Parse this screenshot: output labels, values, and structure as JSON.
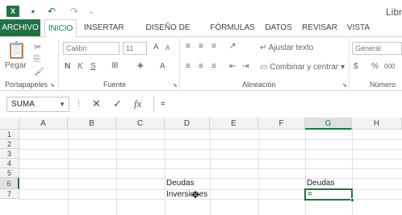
{
  "titlebar": {
    "app_icon": "excel-icon",
    "title": "Libr"
  },
  "tabs": [
    "ARCHIVO",
    "INICIO",
    "INSERTAR",
    "DISEÑO DE PÁGINA",
    "FÓRMULAS",
    "DATOS",
    "REVISAR",
    "VISTA"
  ],
  "ribbon": {
    "clipboard": {
      "paste_label": "Pegar",
      "group_label": "Portapapeles"
    },
    "font": {
      "font_name": "Calibri",
      "font_size": "11",
      "bold": "N",
      "italic": "K",
      "underline": "S",
      "grow": "A",
      "shrink": "A",
      "group_label": "Fuente"
    },
    "alignment": {
      "wrap_text": "Ajustar texto",
      "merge_center": "Combinar y centrar",
      "group_label": "Alineación"
    },
    "number": {
      "format": "General",
      "percent": "%",
      "thousands": "000",
      "group_label": "Número"
    }
  },
  "formula_bar": {
    "name_box": "SUMA",
    "cancel_icon": "✕",
    "enter_icon": "✓",
    "fx": "fx",
    "content": "="
  },
  "grid": {
    "columns": [
      "A",
      "B",
      "C",
      "D",
      "E",
      "F",
      "G",
      "H"
    ],
    "rows": [
      "1",
      "2",
      "3",
      "4",
      "5",
      "6",
      "7"
    ],
    "cells": {
      "D5": "Deudas",
      "D6": "Inversiones",
      "G5": "Deudas",
      "G6": "="
    },
    "selected_column": "G",
    "selected_row": "6"
  }
}
